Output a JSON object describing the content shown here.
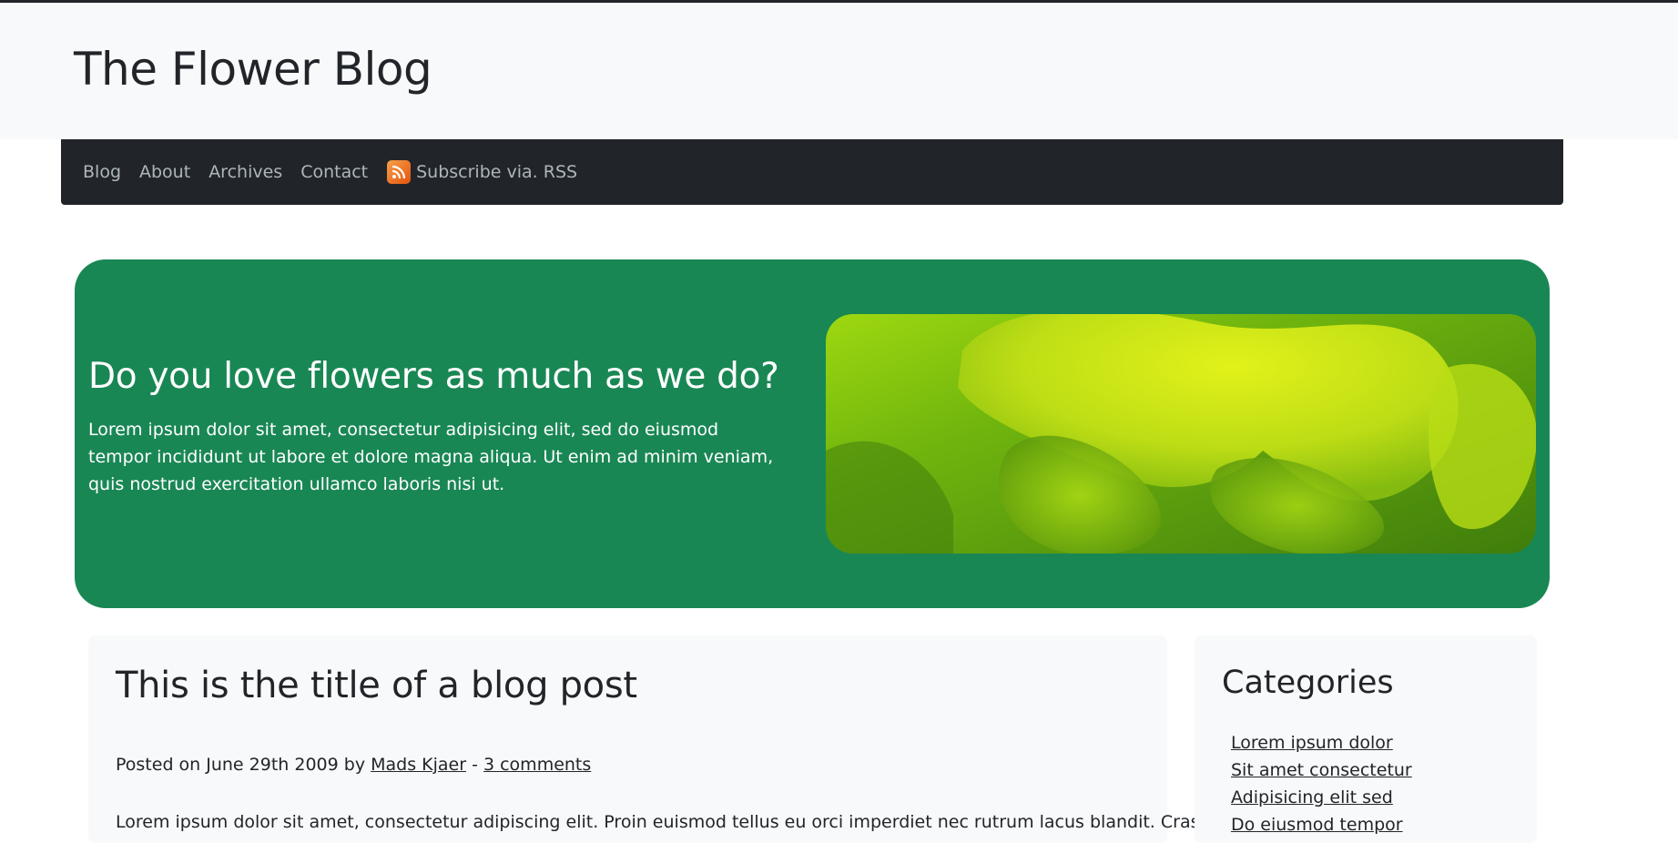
{
  "site": {
    "title": "The Flower Blog"
  },
  "nav": {
    "items": [
      {
        "label": "Blog"
      },
      {
        "label": "About"
      },
      {
        "label": "Archives"
      },
      {
        "label": "Contact"
      }
    ],
    "rss_label": "Subscribe via. RSS"
  },
  "hero": {
    "heading": "Do you love flowers as much as we do?",
    "text": "Lorem ipsum dolor sit amet, consectetur adipisicing elit, sed do eiusmod tempor incididunt ut labore et dolore magna aliqua. Ut enim ad minim veniam, quis nostrud exercitation ullamco laboris nisi ut."
  },
  "post": {
    "title": "This is the title of a blog post",
    "meta_prefix": "Posted on June 29th 2009 by ",
    "author": "Mads Kjaer",
    "separator": " - ",
    "comments": "3 comments",
    "body": "Lorem ipsum dolor sit amet, consectetur adipiscing elit. Proin euismod tellus eu orci imperdiet nec rutrum lacus blandit. Cras"
  },
  "sidebar": {
    "title": "Categories",
    "items": [
      {
        "label": "Lorem ipsum dolor"
      },
      {
        "label": "Sit amet consectetur"
      },
      {
        "label": "Adipisicing elit sed"
      },
      {
        "label": "Do eiusmod tempor"
      }
    ]
  },
  "colors": {
    "hero_bg": "#198754",
    "navbar_bg": "#212529",
    "nav_text": "#adb5bd",
    "card_bg": "#f8f9fa"
  },
  "icons": {
    "rss": "rss-icon"
  }
}
